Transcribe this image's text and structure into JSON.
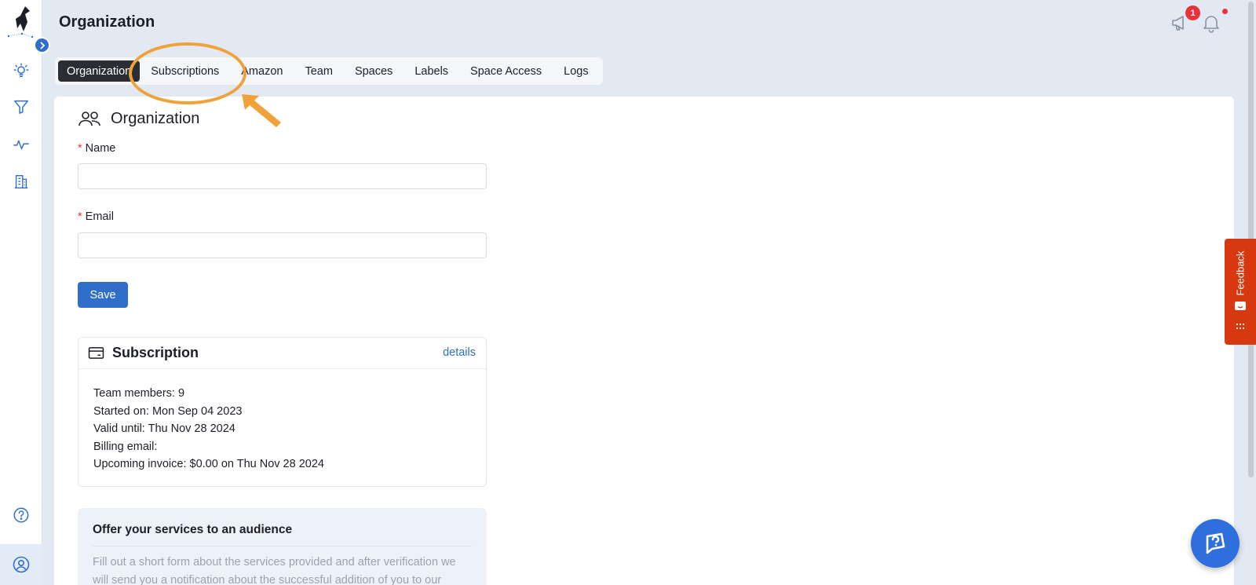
{
  "header": {
    "title": "Organization",
    "notification_count": "1"
  },
  "tabs": [
    {
      "label": "Organization",
      "active": true
    },
    {
      "label": "Subscriptions"
    },
    {
      "label": "Amazon"
    },
    {
      "label": "Team"
    },
    {
      "label": "Spaces"
    },
    {
      "label": "Labels"
    },
    {
      "label": "Space Access"
    },
    {
      "label": "Logs"
    }
  ],
  "organization_form": {
    "section_title": "Organization",
    "required_marker": "*",
    "name_label": "Name",
    "name_value": "",
    "email_label": "Email",
    "email_value": "",
    "save_label": "Save"
  },
  "subscription": {
    "title": "Subscription",
    "details_link": "details",
    "lines": [
      "Team members: 9",
      "Started on: Mon Sep 04 2023",
      "Valid until: Thu Nov 28 2024",
      "Billing email:",
      "Upcoming invoice: $0.00 on Thu Nov 28 2024"
    ]
  },
  "offer": {
    "title": "Offer your services to an audience",
    "text": "Fill out a short form about the services provided and after verification we will send you a notification about the successful addition of you to our"
  },
  "feedback": {
    "label": "Feedback"
  },
  "colors": {
    "accent": "#2f6fca",
    "annotation": "#f0a23a",
    "feedback": "#d7380f",
    "badge": "#e8333c"
  },
  "icons": {
    "sidebar": [
      "lightbulb-icon",
      "filter-icon",
      "activity-icon",
      "building-icon",
      "help-circle-icon",
      "user-circle-icon"
    ],
    "header": [
      "megaphone-icon",
      "bell-icon"
    ]
  }
}
